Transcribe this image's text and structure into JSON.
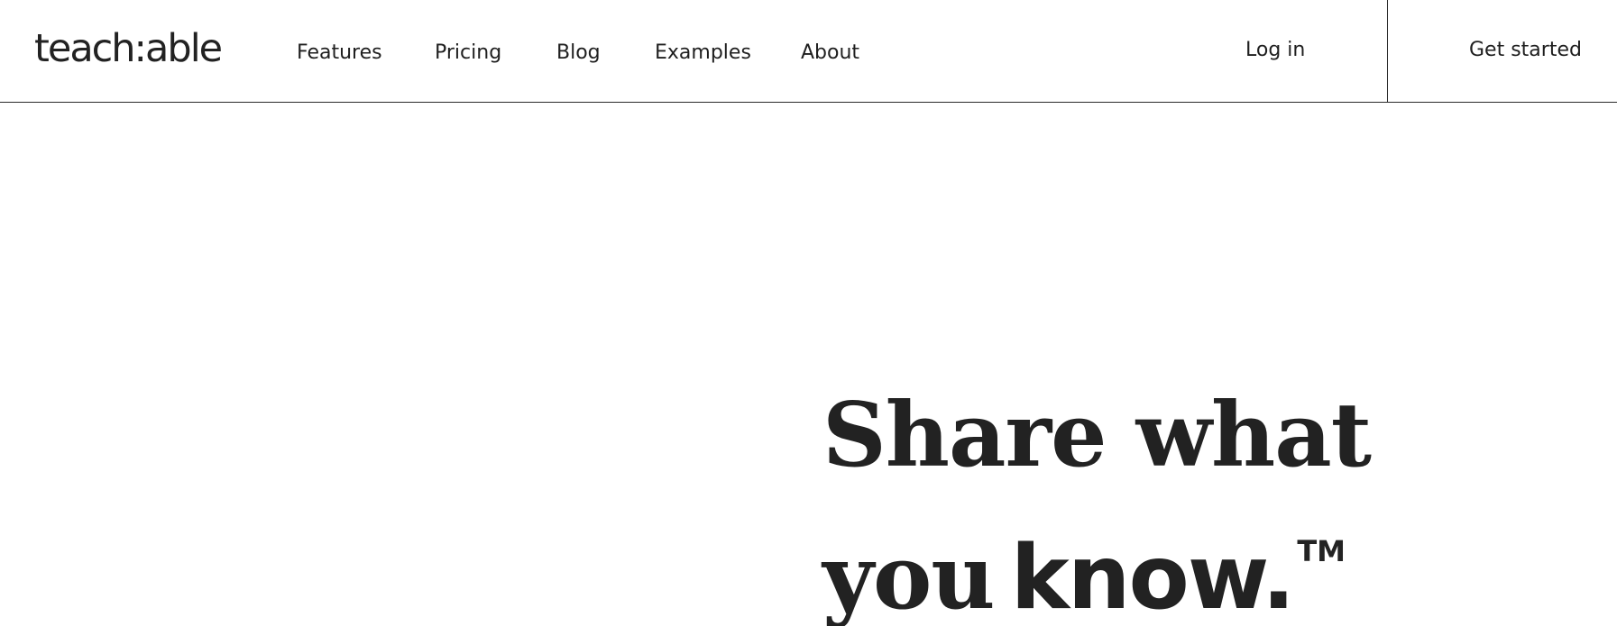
{
  "header": {
    "logo_text": "teach:able",
    "nav": [
      {
        "label": "Features"
      },
      {
        "label": "Pricing"
      },
      {
        "label": "Blog"
      },
      {
        "label": "Examples"
      },
      {
        "label": "About"
      }
    ],
    "login_label": "Log in",
    "get_started_label": "Get started"
  },
  "hero": {
    "line1": "Share what",
    "line2_serif": "you",
    "line2_sans": "know.",
    "trademark": "TM"
  },
  "colors": {
    "text": "#1f1f1f",
    "background": "#ffffff",
    "border": "#2a2a2a"
  }
}
